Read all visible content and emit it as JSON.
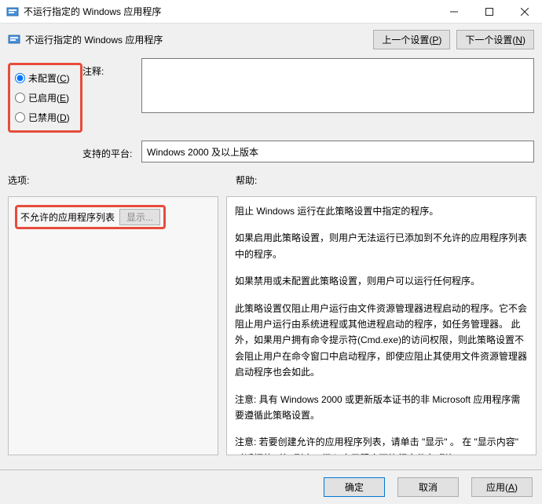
{
  "window": {
    "title": "不运行指定的 Windows 应用程序"
  },
  "header": {
    "title": "不运行指定的 Windows 应用程序",
    "prev_setting": "上一个设置(P)",
    "next_setting": "下一个设置(N)"
  },
  "radios": {
    "not_configured": "未配置(C)",
    "enabled": "已启用(E)",
    "disabled": "已禁用(D)",
    "selected": "not_configured"
  },
  "labels": {
    "annotation": "注释:",
    "supported_on": "支持的平台:",
    "options": "选项:",
    "help": "帮助:"
  },
  "fields": {
    "annotation_value": "",
    "supported_on_value": "Windows 2000 及以上版本"
  },
  "options_panel": {
    "list_label": "不允许的应用程序列表",
    "show_button": "显示..."
  },
  "help_text": {
    "p1": "阻止 Windows 运行在此策略设置中指定的程序。",
    "p2": "如果启用此策略设置，则用户无法运行已添加到不允许的应用程序列表中的程序。",
    "p3": "如果禁用或未配置此策略设置，则用户可以运行任何程序。",
    "p4": "此策略设置仅阻止用户运行由文件资源管理器进程启动的程序。它不会阻止用户运行由系统进程或其他进程启动的程序，如任务管理器。 此外，如果用户拥有命令提示符(Cmd.exe)的访问权限，则此策略设置不会阻止用户在命令窗口中启动程序，即使应阻止其使用文件资源管理器启动程序也会如此。",
    "p5": "注意: 具有 Windows 2000 或更新版本证书的非 Microsoft 应用程序需要遵循此策略设置。",
    "p6": "注意: 若要创建允许的应用程序列表，请单击 \"显示\" 。 在 \"显示内容\" 对话框的 \"值\" 列中，键入应用程序可执行文件名(例如，Winword.exe、Poledit.exe 或 Powerpnt.exe)。"
  },
  "footer": {
    "ok": "确定",
    "cancel": "取消",
    "apply": "应用(A)"
  }
}
